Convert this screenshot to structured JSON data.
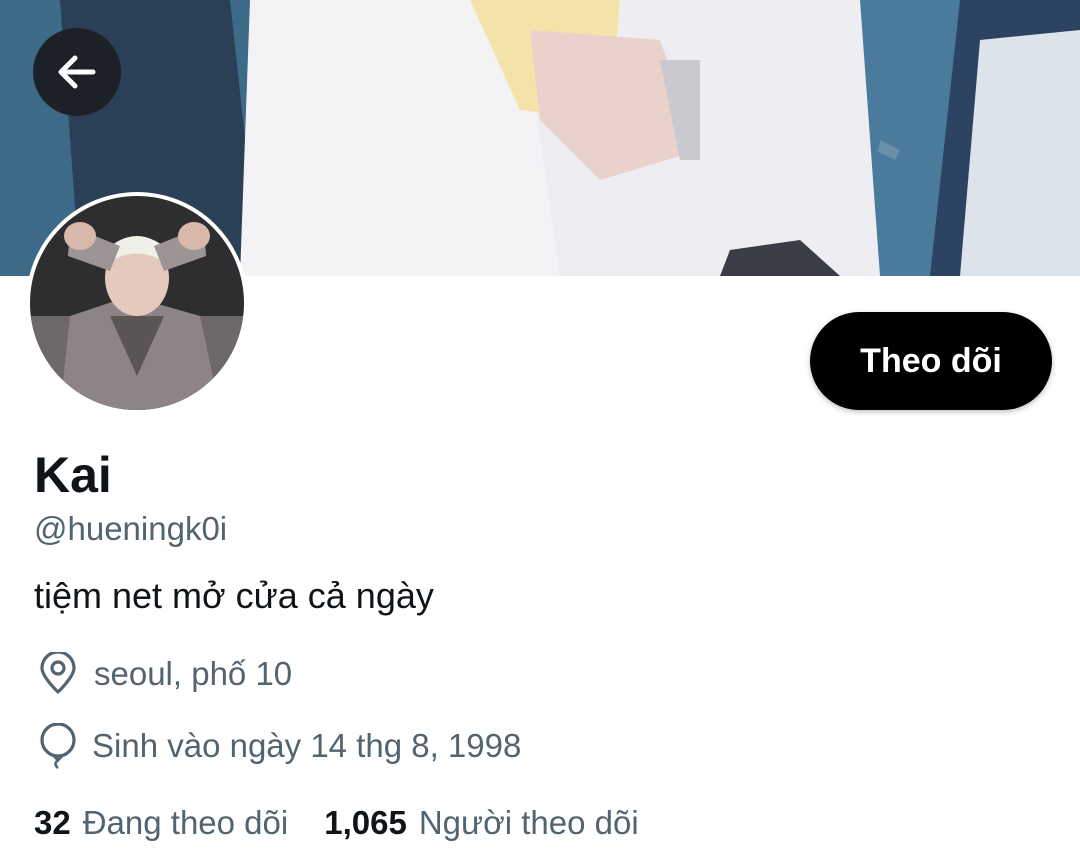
{
  "profile": {
    "display_name": "Kai",
    "handle": "@hueningk0i",
    "bio": "tiệm net mở cửa cả ngày",
    "location": "seoul, phố 10",
    "birthday": "Sinh vào ngày 14 thg 8, 1998"
  },
  "actions": {
    "follow_label": "Theo dõi"
  },
  "stats": {
    "following_count": "32",
    "following_label": "Đang theo dõi",
    "followers_count": "1,065",
    "followers_label": "Người theo dõi"
  },
  "icons": {
    "back": "arrow-left-icon",
    "location": "location-pin-icon",
    "birthday": "balloon-icon"
  },
  "colors": {
    "primary_text": "#0f1419",
    "secondary_text": "#536471",
    "follow_button_bg": "#000000",
    "back_button_bg": "#1b2126"
  }
}
